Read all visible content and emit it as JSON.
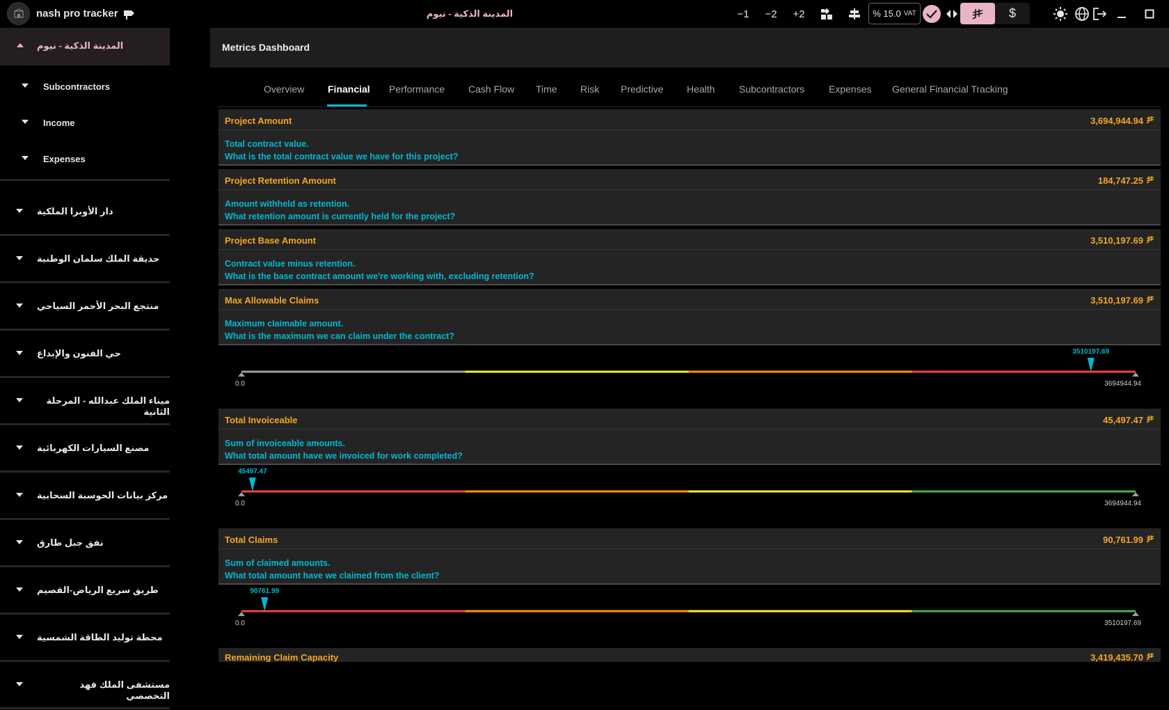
{
  "app": {
    "name": "nash pro tracker",
    "window_title": "المدينة الذكية - نيوم"
  },
  "toolbar": {
    "minus1": "−1",
    "minus2": "−2",
    "plus2": "+2",
    "vat_value": "% 15.0",
    "vat_label": "VAT",
    "usd_symbol": "$"
  },
  "colors": {
    "accent": "#00b8d4",
    "highlight": "#e8b4c8",
    "value": "#f5a623",
    "gauge_gray": "#9e9e9e",
    "gauge_yellow": "#ffeb3b",
    "gauge_orange": "#ff9800",
    "gauge_red": "#f44336",
    "gauge_green": "#4caf50"
  },
  "sidebar": {
    "active_project": "المدينة الذكية - نيوم",
    "sub_items": [
      "Subcontractors",
      "Income",
      "Expenses"
    ],
    "projects": [
      "دار الأوبرا الملكية",
      "حديقة الملك سلمان الوطنية",
      "منتجع البحر الأحمر السياحي",
      "حي الفنون والإبداع",
      "ميناء الملك عبدالله - المرحلة الثانية",
      "مصنع السيارات الكهربائية",
      "مركز بيانات الحوسبة السحابية",
      "نفق جبل طارق",
      "طريق سريع الرياض-القصيم",
      "محطة توليد الطاقة الشمسية",
      "مستشفى الملك فهد التخصصي"
    ]
  },
  "dashboard": {
    "title": "Metrics Dashboard",
    "tabs": [
      "Overview",
      "Financial",
      "Performance",
      "Cash Flow",
      "Time",
      "Risk",
      "Predictive",
      "Health",
      "Subcontractors",
      "Expenses",
      "General Financial Tracking"
    ],
    "active_tab": "Financial",
    "metrics": [
      {
        "title": "Project Amount",
        "value": "3,694,944.94",
        "desc": "Total contract value.",
        "question": "What is the total contract value we have for this project?"
      },
      {
        "title": "Project Retention Amount",
        "value": "184,747.25",
        "desc": "Amount withheld as retention.",
        "question": "What retention amount is currently held for the project?"
      },
      {
        "title": "Project Base Amount",
        "value": "3,510,197.69",
        "desc": "Contract value minus retention.",
        "question": "What is the base contract amount we're working with, excluding retention?"
      },
      {
        "title": "Max Allowable Claims",
        "value": "3,510,197.69",
        "desc": "Maximum claimable amount.",
        "question": "What is the maximum we can claim under the contract?"
      },
      {
        "title": "Total Invoiceable",
        "value": "45,497.47",
        "desc": "Sum of invoiceable amounts.",
        "question": "What total amount have we invoiced for work completed?"
      },
      {
        "title": "Total Claims",
        "value": "90,761.99",
        "desc": "Sum of claimed amounts.",
        "question": "What total amount have we claimed from the client?"
      },
      {
        "title": "Remaining Claim Capacity",
        "value": "3,419,435.70"
      }
    ],
    "gauges": [
      {
        "min": "0.0",
        "max": "3694944.94",
        "value": 3510197.69,
        "value_label": "3510197.69",
        "max_num": 3694944.94,
        "scheme": "gray-yellow-orange-red"
      },
      {
        "min": "0.0",
        "max": "3694944.94",
        "value": 45497.47,
        "value_label": "45497.47",
        "max_num": 3694944.94,
        "scheme": "red-orange-yellow-green"
      },
      {
        "min": "0.0",
        "max": "3510197.69",
        "value": 90761.99,
        "value_label": "90761.99",
        "max_num": 3510197.69,
        "scheme": "red-orange-yellow-green"
      }
    ]
  }
}
